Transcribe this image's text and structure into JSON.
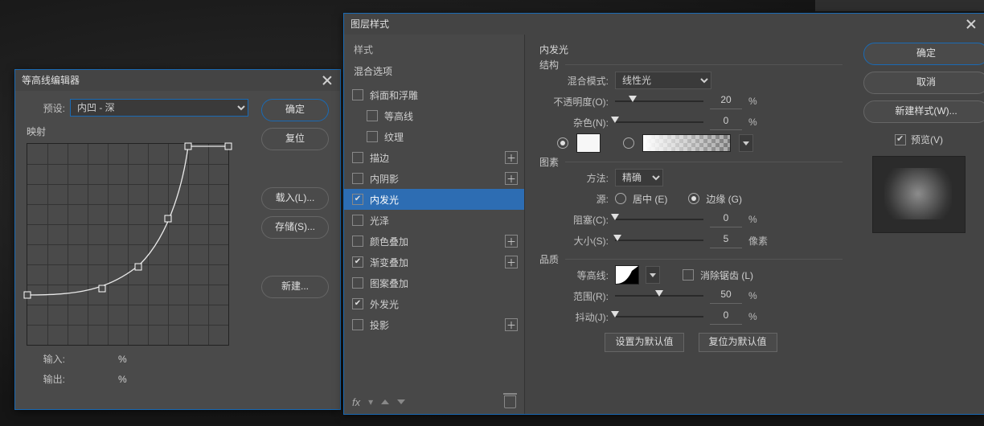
{
  "contour": {
    "title": "等高线编辑器",
    "preset_label": "预设:",
    "preset_value": "内凹 - 深",
    "mapping_label": "映射",
    "input_label": "输入:",
    "output_label": "输出:",
    "percent": "%",
    "buttons": {
      "ok": "确定",
      "reset": "复位",
      "load": "载入(L)...",
      "save": "存储(S)...",
      "new": "新建..."
    }
  },
  "layerStyle": {
    "title": "图层样式",
    "leftHeader": "样式",
    "blendOptions": "混合选项",
    "items": [
      {
        "label": "斜面和浮雕",
        "checked": false,
        "plus": false,
        "indent": false
      },
      {
        "label": "等高线",
        "checked": false,
        "plus": false,
        "indent": true
      },
      {
        "label": "纹理",
        "checked": false,
        "plus": false,
        "indent": true
      },
      {
        "label": "描边",
        "checked": false,
        "plus": true,
        "indent": false
      },
      {
        "label": "内阴影",
        "checked": false,
        "plus": true,
        "indent": false
      },
      {
        "label": "内发光",
        "checked": true,
        "plus": false,
        "indent": false,
        "selected": true
      },
      {
        "label": "光泽",
        "checked": false,
        "plus": false,
        "indent": false
      },
      {
        "label": "颜色叠加",
        "checked": false,
        "plus": true,
        "indent": false
      },
      {
        "label": "渐变叠加",
        "checked": true,
        "plus": true,
        "indent": false
      },
      {
        "label": "图案叠加",
        "checked": false,
        "plus": false,
        "indent": false
      },
      {
        "label": "外发光",
        "checked": true,
        "plus": false,
        "indent": false
      },
      {
        "label": "投影",
        "checked": false,
        "plus": true,
        "indent": false
      }
    ],
    "fx": "fx",
    "panelTitle": "内发光",
    "groups": {
      "structure": "结构",
      "element": "图素",
      "quality": "品质"
    },
    "labels": {
      "blendMode": "混合模式:",
      "opacity": "不透明度(O):",
      "noise": "杂色(N):",
      "technique": "方法:",
      "source": "源:",
      "center": "居中 (E)",
      "edge": "边缘 (G)",
      "choke": "阻塞(C):",
      "size": "大小(S):",
      "contour": "等高线:",
      "antialias": "消除锯齿 (L)",
      "range": "范围(R):",
      "jitter": "抖动(J):"
    },
    "values": {
      "blendMode": "线性光",
      "opacity": 20,
      "noise": 0,
      "technique": "精确",
      "sourceEdge": true,
      "choke": 0,
      "size": 5,
      "range": 50,
      "jitter": 0,
      "colorSelected": true,
      "color": "#f7f7f7"
    },
    "units": {
      "percent": "%",
      "px": "像素"
    },
    "buttons": {
      "setDefault": "设置为默认值",
      "resetDefault": "复位为默认值"
    },
    "right": {
      "ok": "确定",
      "cancel": "取消",
      "newStyle": "新建样式(W)...",
      "preview": "预览(V)"
    }
  }
}
